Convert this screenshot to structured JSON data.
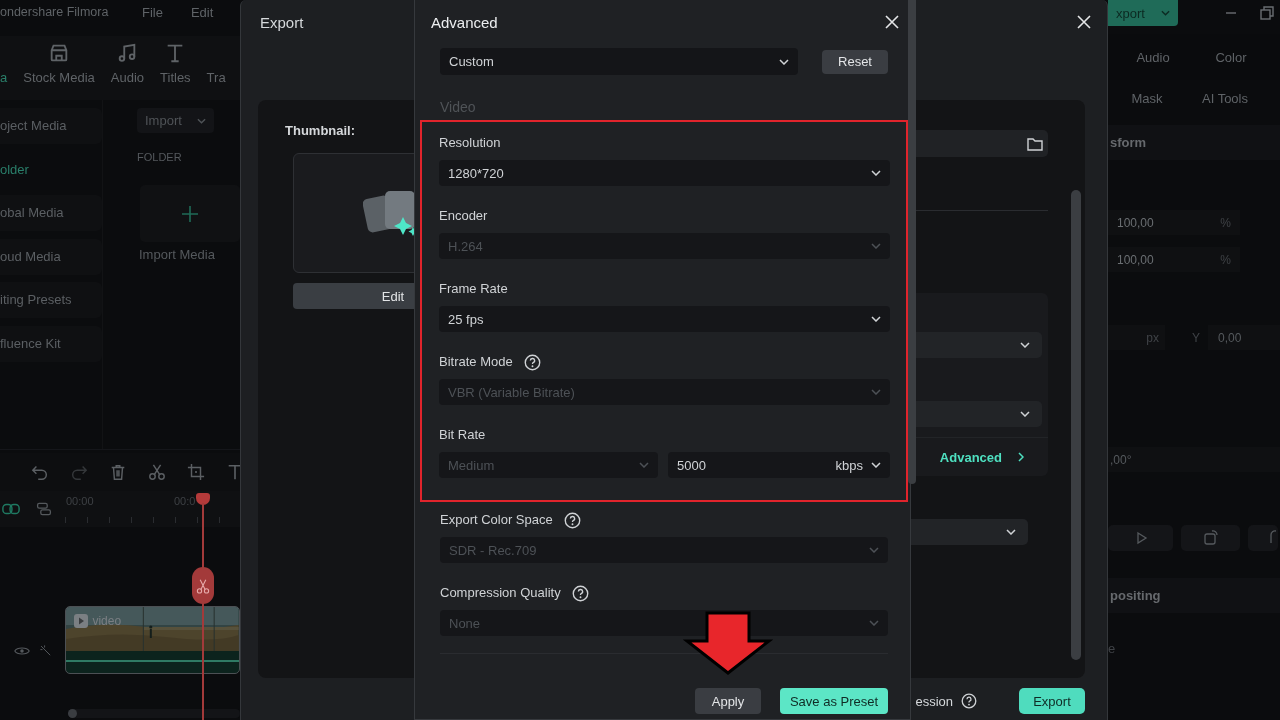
{
  "app": {
    "title": "ondershare Filmora",
    "menu": [
      "File",
      "Edit"
    ],
    "export_button": "xport",
    "toolbar_tabs": [
      {
        "label": "a",
        "selected": true
      },
      {
        "label": "Stock Media",
        "selected": false
      },
      {
        "label": "Audio",
        "selected": false
      },
      {
        "label": "Titles",
        "selected": false
      },
      {
        "label": "Tra",
        "selected": false
      }
    ],
    "sidebar": [
      {
        "label": "oject Media",
        "selected": false
      },
      {
        "label": "older",
        "selected": true
      },
      {
        "label": "obal Media",
        "selected": false
      },
      {
        "label": "oud Media",
        "selected": false
      },
      {
        "label": "iting Presets",
        "selected": false
      },
      {
        "label": "fluence Kit",
        "selected": false
      }
    ],
    "import_button": "Import",
    "folder_heading": "FOLDER",
    "import_media": "Import Media",
    "timeline": {
      "ruler": [
        "00:00",
        "00:0"
      ],
      "clip_label": "video"
    },
    "properties": {
      "tabs": [
        "Audio",
        "Color"
      ],
      "subtabs": [
        "Mask",
        "AI Tools"
      ],
      "section": "sform",
      "scale": [
        {
          "value": "100,00",
          "unit": "%"
        },
        {
          "value": "100,00",
          "unit": "%"
        }
      ],
      "position": {
        "x_unit": "px",
        "y_label": "Y",
        "y_value": "0,00"
      },
      "rotation": ",00°",
      "section_2": "positing",
      "row_label": "e"
    }
  },
  "export_dialog": {
    "title": "Export",
    "thumbnail_label": "Thumbnail:",
    "edit_button": "Edit",
    "advanced_link": "Advanced",
    "footer_label": "ession",
    "export_button": "Export"
  },
  "advanced_dialog": {
    "title": "Advanced",
    "preset": "Custom",
    "reset_button": "Reset",
    "section": "Video",
    "video_fields": [
      {
        "label": "Resolution",
        "value": "1280*720",
        "disabled": false,
        "help": false
      },
      {
        "label": "Encoder",
        "value": "H.264",
        "disabled": true,
        "help": false
      },
      {
        "label": "Frame Rate",
        "value": "25 fps",
        "disabled": false,
        "help": false
      },
      {
        "label": "Bitrate Mode",
        "value": "VBR (Variable Bitrate)",
        "disabled": true,
        "help": true
      }
    ],
    "bit_rate": {
      "label": "Bit Rate",
      "preset": "Medium",
      "preset_disabled": true,
      "value": "5000",
      "unit": "kbps"
    },
    "fields": [
      {
        "label": "Export Color Space",
        "value": "SDR - Rec.709",
        "disabled": true,
        "help": true
      },
      {
        "label": "Compression Quality",
        "value": "None",
        "disabled": true,
        "help": true
      }
    ],
    "apply_button": "Apply",
    "save_button": "Save as Preset"
  }
}
